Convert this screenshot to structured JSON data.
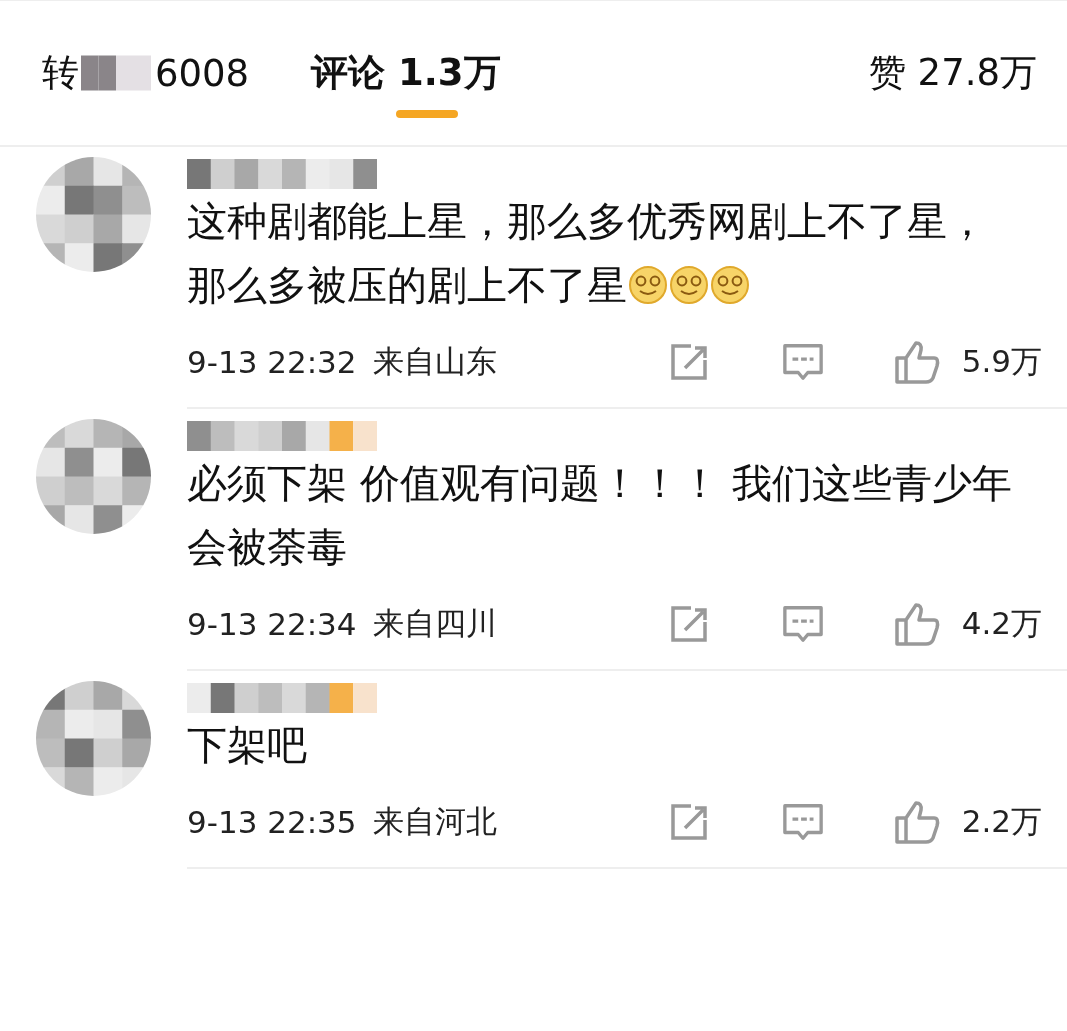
{
  "tabs": [
    {
      "kind": "repost",
      "label": "转",
      "count": "6008",
      "selected": false
    },
    {
      "kind": "comments",
      "label": "评论 1.3万",
      "selected": true
    },
    {
      "kind": "likes",
      "label": "赞 27.8万",
      "selected": false
    }
  ],
  "comments": [
    {
      "text": "这种剧都能上星，那么多优秀网剧上不了星，那么多被压的剧上不了星",
      "emojis": [
        {
          "kind": "smile"
        },
        {
          "kind": "smile"
        },
        {
          "kind": "smile"
        }
      ],
      "time": "9-13 22:32",
      "location": "来自山东",
      "likes": "5.9万",
      "badge": false
    },
    {
      "text": "必须下架 价值观有问题！！！ 我们这些青少年会被荼毒",
      "time": "9-13 22:34",
      "location": "来自四川",
      "likes": "4.2万",
      "badge": true
    },
    {
      "text": "下架吧",
      "time": "9-13 22:35",
      "location": "来自河北",
      "likes": "2.2万",
      "badge": true
    }
  ]
}
